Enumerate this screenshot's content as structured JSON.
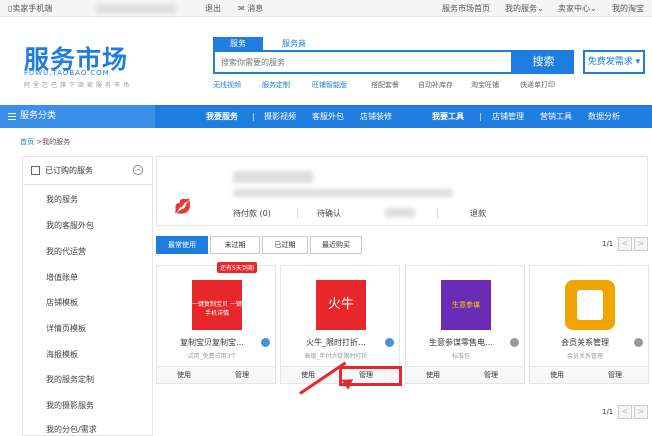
{
  "topbar": {
    "mobile": "卖家手机端",
    "logout": "退出",
    "message": "消息",
    "market_home": "服务市场首页",
    "my_service": "我的服务",
    "seller_center": "卖家中心",
    "my_taobao": "我的淘宝"
  },
  "logo": {
    "cn": "服务市场",
    "en": "FUWU.TAOBAO.COM",
    "slogan": "阿里巴巴旗下商家服务市场"
  },
  "search": {
    "tab_service": "服务",
    "tab_provider": "服务商",
    "placeholder": "搜索你需要的服务",
    "button": "搜索",
    "free_request": "免费发需求"
  },
  "hotlinks": [
    "无线视频",
    "服务定制",
    "旺铺智能版",
    "搭配套餐",
    "自动补库存",
    "淘宝旺铺",
    "快递单打印"
  ],
  "nav": {
    "category": "服务分类",
    "my_service": "我要服务",
    "items1": [
      "摄影视频",
      "客服外包",
      "店铺装修"
    ],
    "my_tools": "我要工具",
    "items2": [
      "店铺管理",
      "营销工具",
      "数据分析"
    ]
  },
  "breadcrumb": {
    "home": "首页",
    "current": ">我的服务"
  },
  "sidebar": {
    "header": "已订购的服务",
    "items": [
      "我的服务",
      "我的客服外包",
      "我的代运营",
      "增值账单",
      "店铺模板",
      "详情页模板",
      "海报模板",
      "我的服务定制",
      "我的摄影服务",
      "我的分包/需求"
    ]
  },
  "orders": {
    "pending_pay": "待付款",
    "pending_pay_count": "(0)",
    "pending_confirm": "待确认",
    "refund": "退款"
  },
  "filter_tabs": [
    "最常使用",
    "未过期",
    "已过期",
    "最近购买"
  ],
  "pager": {
    "text": "1/1",
    "prev": "<",
    "next": ">"
  },
  "cards": [
    {
      "name": "复制宝贝复制宝…",
      "sub": "试用_免费试用3个",
      "badge": "还有5天到期",
      "thumb_text": "一键复制宝贝 一键手机详情",
      "use": "使用",
      "manage": "管理"
    },
    {
      "name": "火牛_限时打折…",
      "sub": "高级_年付大促限时打折",
      "badge": "",
      "thumb_text": "火牛",
      "use": "使用",
      "manage": "管理"
    },
    {
      "name": "生意参谋零售电…",
      "sub": "标准包",
      "badge": "",
      "thumb_text": "生意参谋",
      "use": "使用",
      "manage": "管理"
    },
    {
      "name": "会员关系管理",
      "sub": "会员关系管理",
      "badge": "",
      "thumb_text": "",
      "use": "使用",
      "manage": "管理"
    }
  ],
  "colors": {
    "brand": "#1f7de0",
    "alert": "#e8272b"
  }
}
